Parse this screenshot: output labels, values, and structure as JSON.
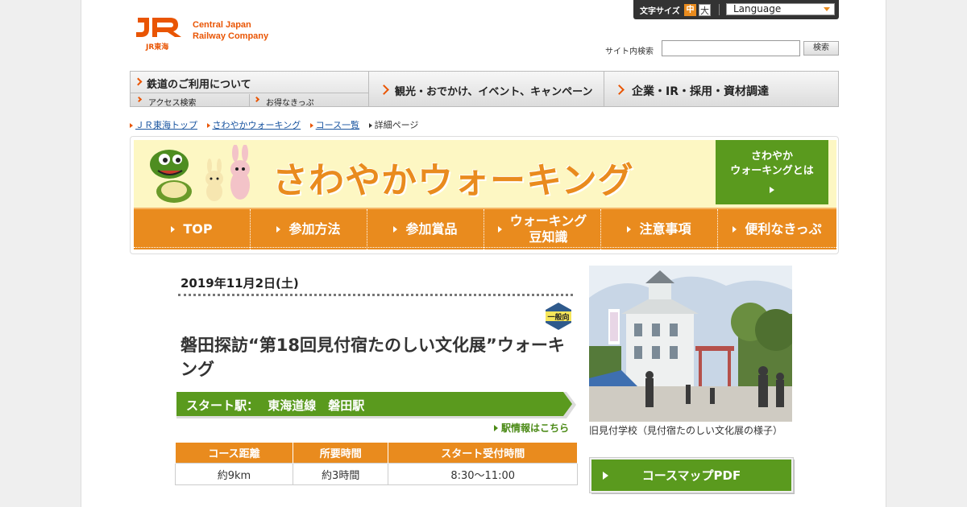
{
  "header": {
    "logo_jr": "JR",
    "logo_sub": "JR東海",
    "logo_en_line1": "Central Japan",
    "logo_en_line2": "Railway Company",
    "font_size_label": "文字サイズ",
    "font_size_mid": "中",
    "font_size_big": "大",
    "language_label": "Language",
    "search_label": "サイト内検索",
    "search_value": "",
    "search_button": "検索"
  },
  "gnav": {
    "item1": "鉄道のご利用について",
    "item1_sub1": "アクセス検索",
    "item1_sub2": "お得なきっぷ",
    "item2": "観光・おでかけ、イベント、キャンペーン",
    "item3": "企業・IR・採用・資材調達"
  },
  "breadcrumb": [
    "ＪＲ東海トップ",
    "さわやかウォーキング",
    "コース一覧",
    "詳細ページ"
  ],
  "banner": {
    "title": "さわやかウォーキング",
    "about_line1": "さわやか",
    "about_line2": "ウォーキングとは",
    "nav": [
      "TOP",
      "参加方法",
      "参加賞品",
      "ウォーキング",
      "豆知識",
      "注意事項",
      "便利なきっぷ"
    ]
  },
  "course": {
    "date": "2019年11月2日(土)",
    "badge": "一般向",
    "title": "磐田探訪“第18回見付宿たのしい文化展”ウォーキング",
    "start_label": "スタート駅：",
    "start_station": "東海道線　磐田駅",
    "station_link": "駅情報はこちら",
    "table_headers": [
      "コース距離",
      "所要時間",
      "スタート受付時間"
    ],
    "table_values": [
      "約9km",
      "約3時間",
      "8:30～11:00"
    ],
    "photo_caption": "旧見付学校（見付宿たのしい文化展の様子）",
    "pdf_button": "コースマップPDF"
  },
  "colors": {
    "jr_orange": "#e95504",
    "walking_orange": "#e98b1e",
    "walking_green": "#5a9a1e",
    "link_blue": "#1a55a0"
  }
}
